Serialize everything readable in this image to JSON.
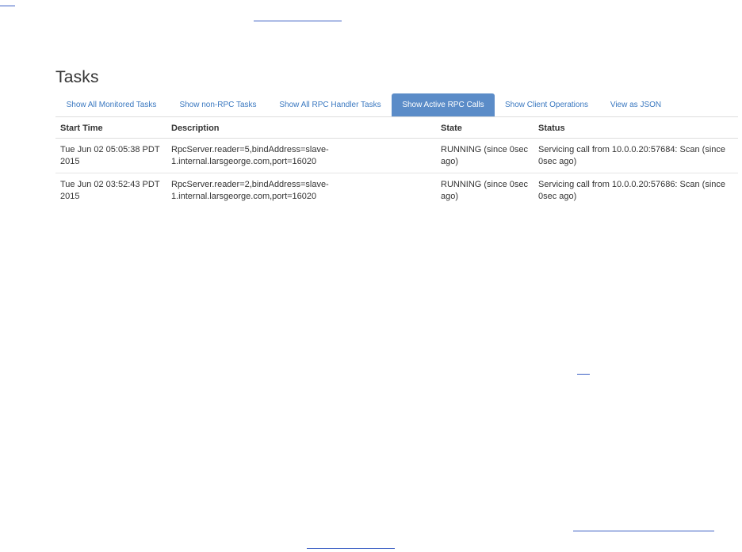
{
  "page_title": "Tasks",
  "tabs": [
    {
      "label": "Show All Monitored Tasks",
      "active": false
    },
    {
      "label": "Show non-RPC Tasks",
      "active": false
    },
    {
      "label": "Show All RPC Handler Tasks",
      "active": false
    },
    {
      "label": "Show Active RPC Calls",
      "active": true
    },
    {
      "label": "Show Client Operations",
      "active": false
    },
    {
      "label": "View as JSON",
      "active": false
    }
  ],
  "table": {
    "headers": {
      "start_time": "Start Time",
      "description": "Description",
      "state": "State",
      "status": "Status"
    },
    "rows": [
      {
        "start_time": "Tue Jun 02 05:05:38 PDT 2015",
        "description": "RpcServer.reader=5,bindAddress=slave-1.internal.larsgeorge.com,port=16020",
        "state": "RUNNING (since 0sec ago)",
        "status": "Servicing call from 10.0.0.20:57684: Scan (since 0sec ago)"
      },
      {
        "start_time": "Tue Jun 02 03:52:43 PDT 2015",
        "description": "RpcServer.reader=2,bindAddress=slave-1.internal.larsgeorge.com,port=16020",
        "state": "RUNNING (since 0sec ago)",
        "status": "Servicing call from 10.0.0.20:57686: Scan (since 0sec ago)"
      }
    ]
  },
  "colors": {
    "link": "#3a78c0",
    "active_tab_bg": "#5b8cc8",
    "text": "#333333",
    "border": "#dddddd"
  }
}
